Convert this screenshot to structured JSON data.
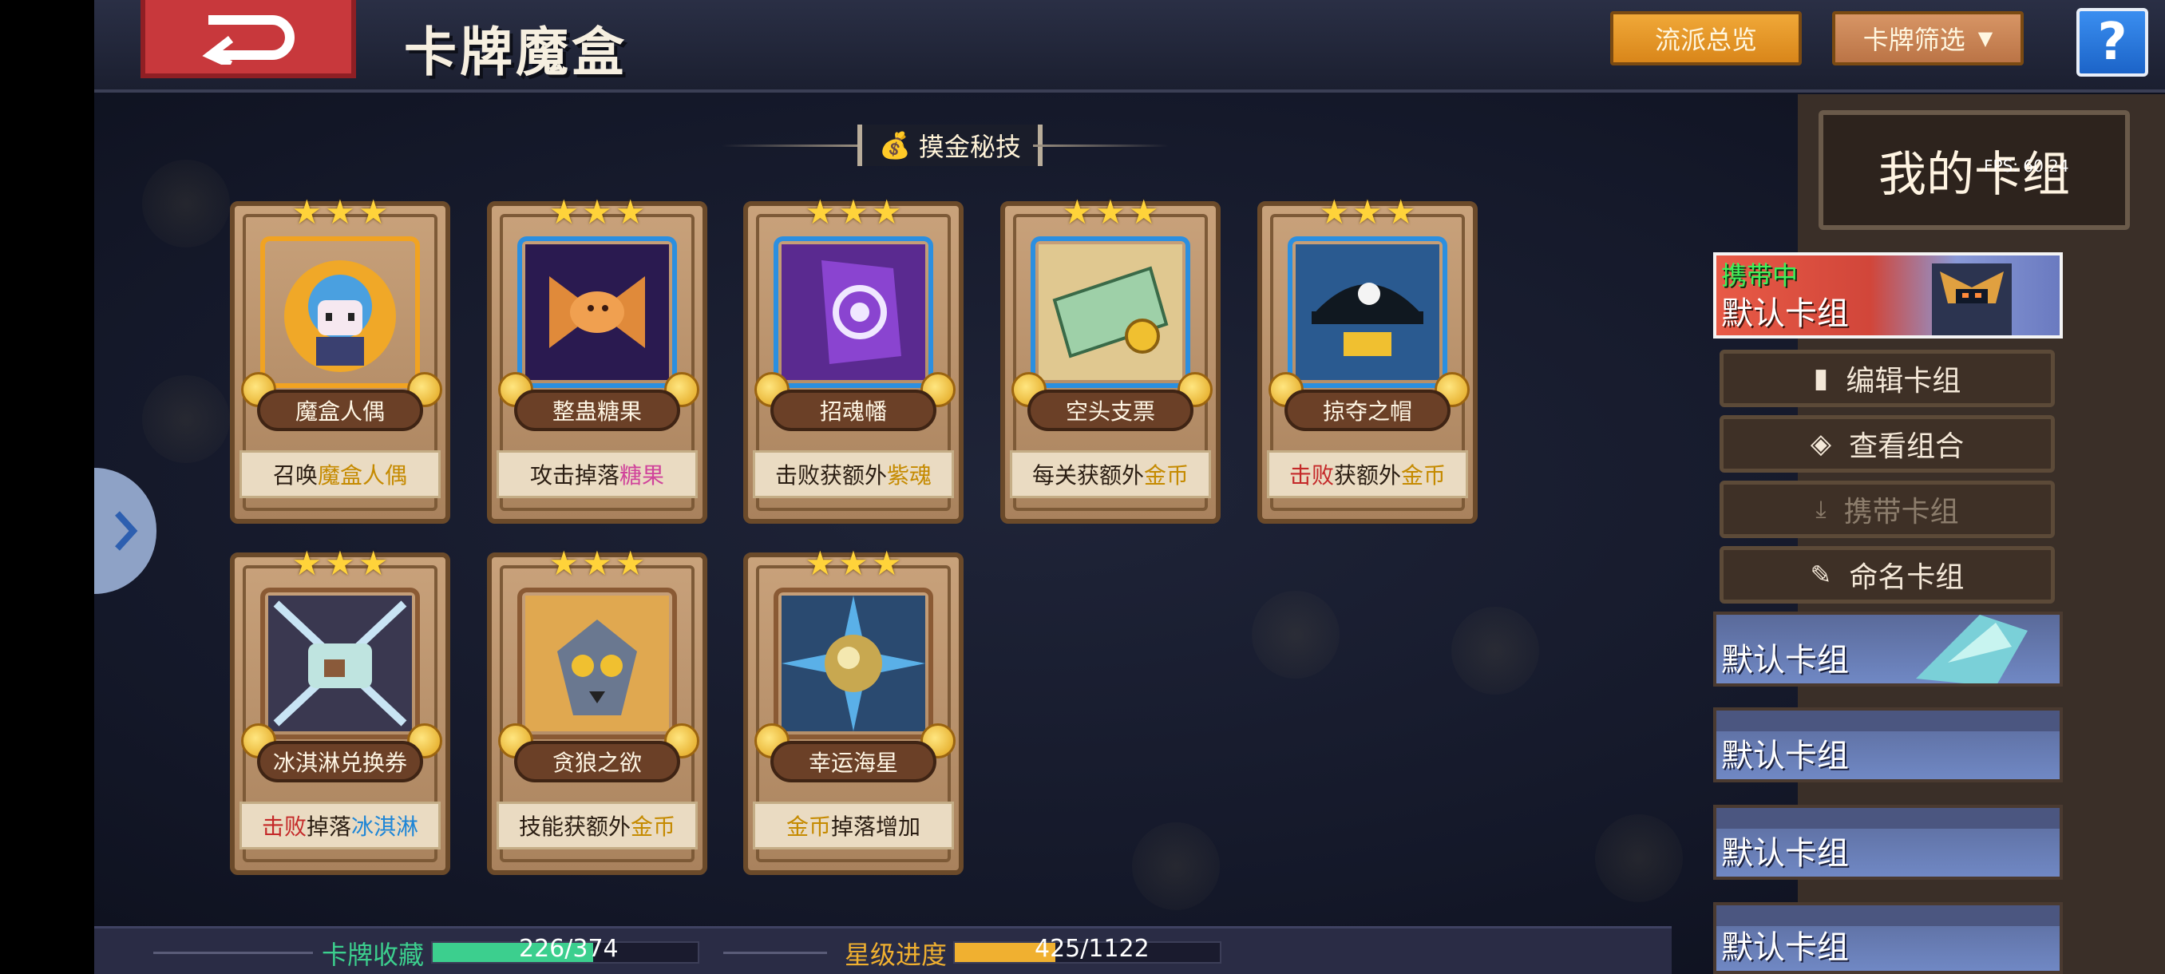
{
  "header": {
    "title": "卡牌魔盒",
    "overview_label": "流派总览",
    "filter_label": "卡牌筛选",
    "help_label": "?"
  },
  "section": {
    "title": "摸金秘技"
  },
  "cards": [
    {
      "name": "魔盒人偶",
      "desc_parts": [
        {
          "t": "召唤",
          "c": ""
        },
        {
          "t": "魔盒人偶",
          "c": "y"
        }
      ],
      "stars": 3,
      "frame": "gold"
    },
    {
      "name": "整蛊糖果",
      "desc_parts": [
        {
          "t": "攻击掉落",
          "c": ""
        },
        {
          "t": "糖果",
          "c": "p"
        }
      ],
      "stars": 3,
      "frame": "blue"
    },
    {
      "name": "招魂幡",
      "desc_parts": [
        {
          "t": "击败获额外",
          "c": ""
        },
        {
          "t": "紫魂",
          "c": "y"
        }
      ],
      "stars": 3,
      "frame": "blue"
    },
    {
      "name": "空头支票",
      "desc_parts": [
        {
          "t": "每关获额外",
          "c": ""
        },
        {
          "t": "金币",
          "c": "y"
        }
      ],
      "stars": 3,
      "frame": "blue"
    },
    {
      "name": "掠夺之帽",
      "desc_parts": [
        {
          "t": "击败",
          "c": "r"
        },
        {
          "t": "获额外",
          "c": ""
        },
        {
          "t": "金币",
          "c": "y"
        }
      ],
      "stars": 3,
      "frame": "blue"
    },
    {
      "name": "冰淇淋兑换券",
      "desc_parts": [
        {
          "t": "击败",
          "c": "r"
        },
        {
          "t": "掉落",
          "c": ""
        },
        {
          "t": "冰淇淋",
          "c": "b"
        }
      ],
      "stars": 3,
      "frame": "bronze"
    },
    {
      "name": "贪狼之欲",
      "desc_parts": [
        {
          "t": "技能获额外",
          "c": ""
        },
        {
          "t": "金币",
          "c": "y"
        }
      ],
      "stars": 3,
      "frame": "bronze"
    },
    {
      "name": "幸运海星",
      "desc_parts": [
        {
          "t": "金币",
          "c": "y"
        },
        {
          "t": "掉落增加",
          "c": ""
        }
      ],
      "stars": 3,
      "frame": "bronze"
    }
  ],
  "bottom": {
    "collection_label": "卡牌收藏",
    "collection_value": "226/374",
    "collection_fraction": 0.604,
    "star_label": "星级进度",
    "star_value": "425/1122",
    "star_fraction": 0.379
  },
  "right_panel": {
    "title": "我的卡组",
    "fps": "FPS: 60.24",
    "active_deck": {
      "status": "携带中",
      "name": "默认卡组"
    },
    "buttons": {
      "edit": "编辑卡组",
      "view": "查看组合",
      "carry": "携带卡组",
      "rename": "命名卡组"
    },
    "decks": [
      "默认卡组",
      "默认卡组",
      "默认卡组",
      "默认卡组"
    ]
  },
  "colors": {
    "accent_orange": "#f0a838",
    "back_red": "#c8383c",
    "help_blue": "#3a8ef0",
    "collection_green": "#3ccf8e",
    "star_gold": "#f0b030"
  }
}
